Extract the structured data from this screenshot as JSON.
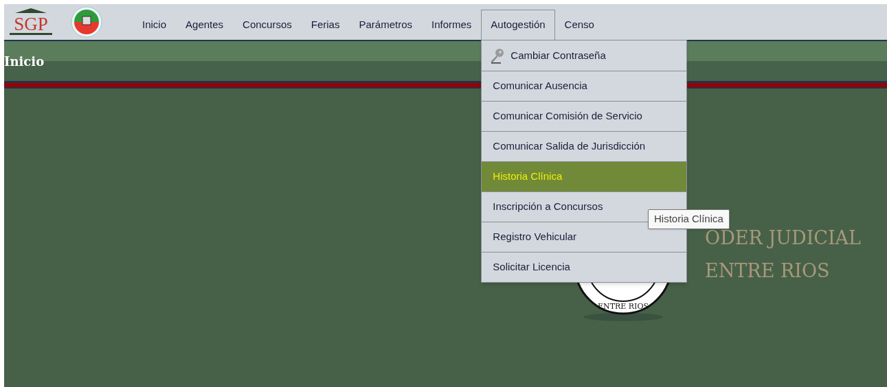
{
  "logo": {
    "text": "SGP"
  },
  "nav": [
    {
      "label": "Inicio",
      "selected": false
    },
    {
      "label": "Agentes",
      "selected": false
    },
    {
      "label": "Concursos",
      "selected": false
    },
    {
      "label": "Ferias",
      "selected": false
    },
    {
      "label": "Parámetros",
      "selected": false
    },
    {
      "label": "Informes",
      "selected": false
    },
    {
      "label": "Autogestión",
      "selected": true
    },
    {
      "label": "Censo",
      "selected": false
    }
  ],
  "menu": [
    {
      "label": "Cambiar Contraseña",
      "kind": "icon",
      "selected": false
    },
    {
      "label": "Comunicar Ausencia",
      "kind": "plain",
      "selected": false
    },
    {
      "label": "Comunicar Comisión de Servicio",
      "kind": "plain",
      "selected": false
    },
    {
      "label": "Comunicar Salida de Jurisdicción",
      "kind": "plain",
      "selected": false
    },
    {
      "label": "Historia Clínica",
      "kind": "plain",
      "selected": true
    },
    {
      "label": "Inscripción a Concursos",
      "kind": "plain",
      "selected": false
    },
    {
      "label": "Registro Vehicular",
      "kind": "plain",
      "selected": false
    },
    {
      "label": "Solicitar Licencia",
      "kind": "plain",
      "selected": false
    }
  ],
  "tooltip": "Historia Clínica",
  "page_title": "Inicio",
  "emblem": {
    "line_1": "ODER JUDICIAL",
    "line_2": "ENTRE RIOS",
    "seal_text": "ENTRE RIOS"
  }
}
